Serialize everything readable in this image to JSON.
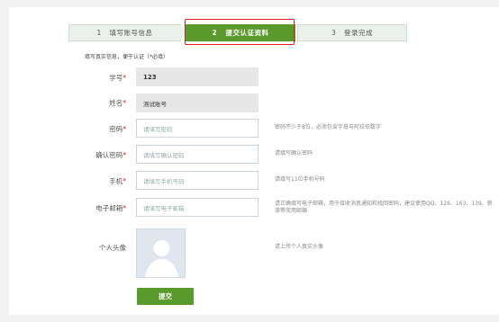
{
  "steps": [
    {
      "number": "1",
      "label": "填写账号信息"
    },
    {
      "number": "2",
      "label": "提交认证资料"
    },
    {
      "number": "3",
      "label": "登录完成"
    }
  ],
  "hint": "填写真实信息，便于认证（*必填）",
  "required_mark": "*",
  "fields": {
    "student_id": {
      "label": "学号",
      "value": "123"
    },
    "name": {
      "label": "姓名",
      "value": "测试账号"
    },
    "password": {
      "label": "密码",
      "placeholder": "请填写密码",
      "tip": "密码不少于8位，必须包含字母与阿拉伯数字"
    },
    "confirm_password": {
      "label": "确认密码",
      "placeholder": "请填写确认密码",
      "tip": "请填写确认密码"
    },
    "phone": {
      "label": "手机",
      "placeholder": "请填写手机号码",
      "tip": "请填写11位手机号码"
    },
    "email": {
      "label": "电子邮箱",
      "placeholder": "请填写电子邮箱",
      "tip": "请正确填写电子邮箱，用于接收消息通知和找回密码，建议使用QQ、126、163、139、新浪等常用邮箱"
    },
    "avatar": {
      "label": "个人头像",
      "tip": "请上传个人真实头像"
    }
  },
  "submit_label": "提交",
  "colors": {
    "accent": "#5a9a2c",
    "highlight": "#e22020",
    "step_inactive": "#eaf1ea"
  }
}
